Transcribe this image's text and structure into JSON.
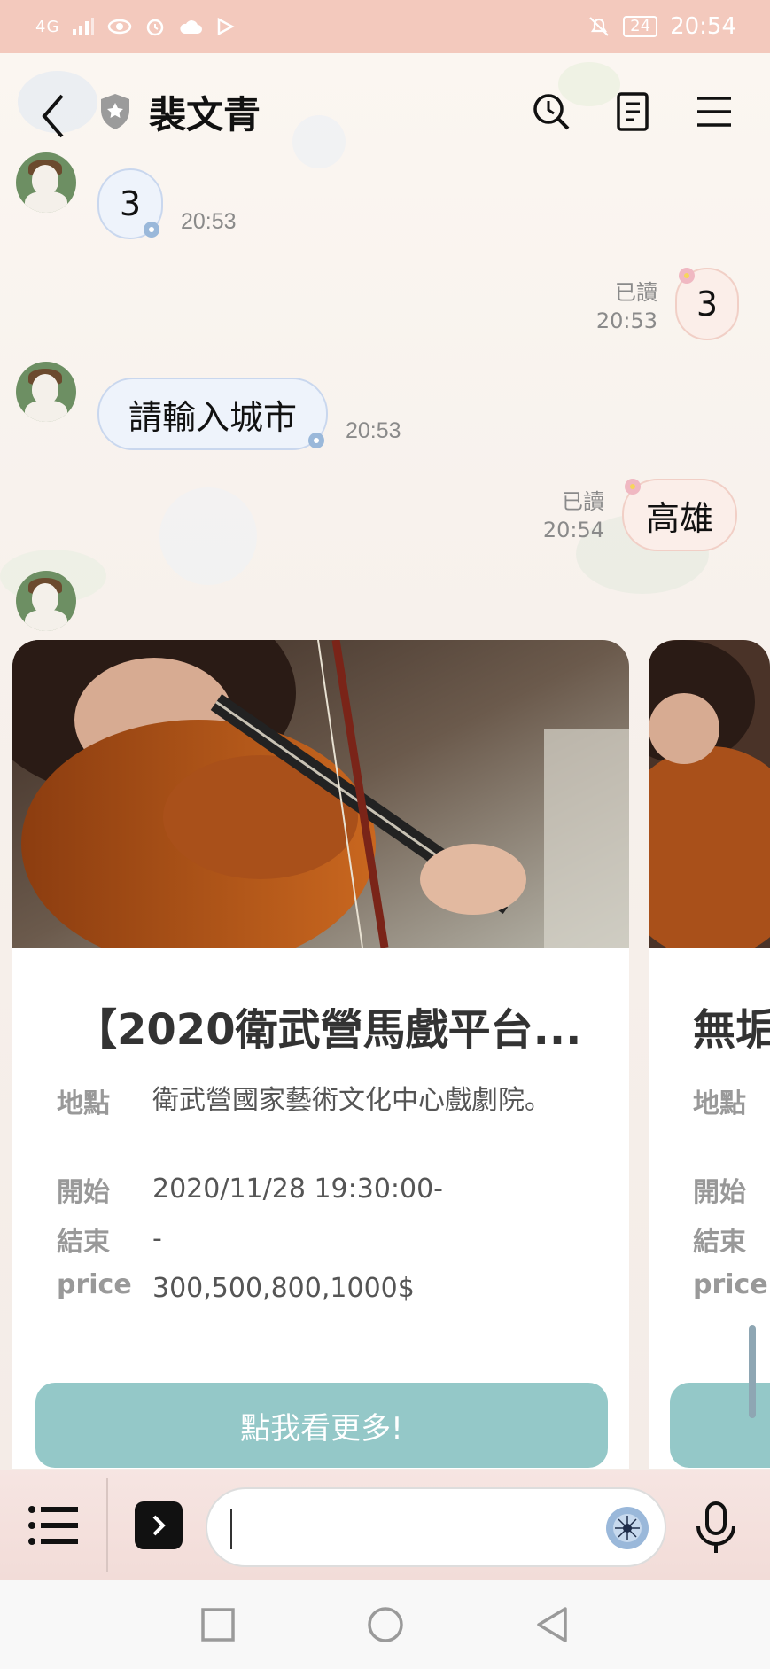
{
  "status_bar": {
    "signal": "4G",
    "battery": "24",
    "time": "20:54"
  },
  "header": {
    "title": "裴文青"
  },
  "messages": [
    {
      "side": "in",
      "text": "3",
      "time": "20:53"
    },
    {
      "side": "out",
      "text": "3",
      "read": "已讀",
      "time": "20:53"
    },
    {
      "side": "in",
      "text": "請輸入城市",
      "time": "20:53"
    },
    {
      "side": "out",
      "text": "高雄",
      "read": "已讀",
      "time": "20:54"
    }
  ],
  "carousel": {
    "cards": [
      {
        "title": "【2020衛武營馬戲平台...",
        "rows": [
          {
            "key": "地點",
            "value": "衛武營國家藝術文化中心戲劇院。"
          },
          {
            "key": "開始",
            "value": "2020/11/28 19:30:00-"
          },
          {
            "key": "結束",
            "value": "-"
          },
          {
            "key": "price",
            "value": "300,500,800,1000$"
          }
        ],
        "button": "點我看更多!"
      },
      {
        "title": "無垢",
        "rows": [
          {
            "key": "地點"
          },
          {
            "key": "開始"
          },
          {
            "key": "結束"
          },
          {
            "key": "price"
          }
        ]
      }
    ]
  },
  "icons": {
    "back": "chevron-left-icon",
    "shield": "shield-star-icon",
    "search_history": "clock-search-icon",
    "notes": "notes-icon",
    "menu": "hamburger-icon",
    "keyboard_menu": "list-icon",
    "expand": "chevron-right-icon",
    "sticker": "sticker-flower-icon",
    "mic": "microphone-icon"
  },
  "colors": {
    "status_bar": "#f3c9bd",
    "more_button": "#94c8c8",
    "bubble_in": "#eef3fb",
    "bubble_out": "#fbeee9"
  }
}
